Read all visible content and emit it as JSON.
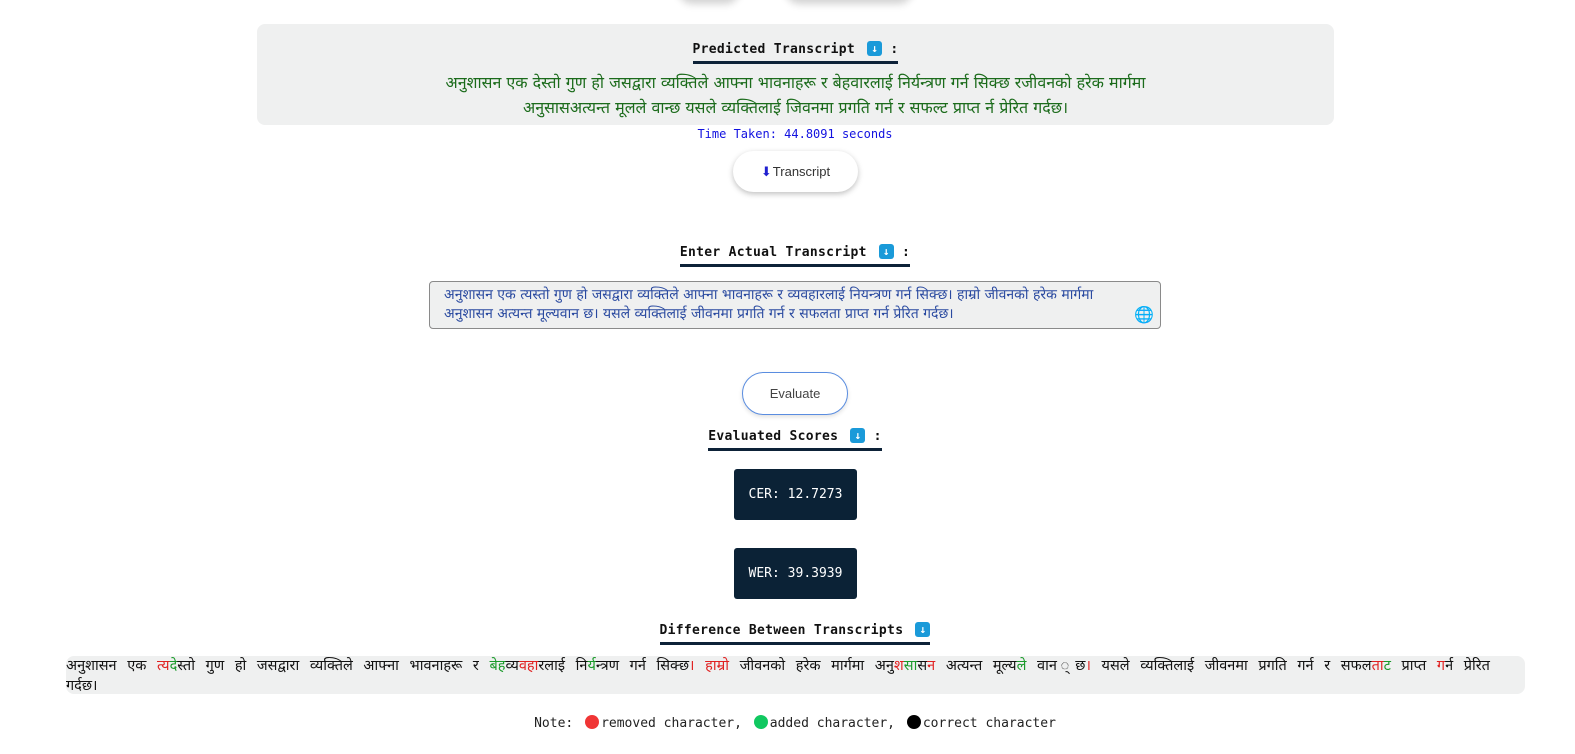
{
  "predicted": {
    "heading": "Predicted Transcript",
    "colon": ":",
    "download_icon": "download-arrow-icon",
    "text": "अनुशासन एक देस्तो गुण हो जसद्वारा व्यक्तिले आफ्ना भावनाहरू र बेहवारलाई निर्यन्त्रण गर्न सिक्छ रजीवनको हरेक मार्गमा अनुसासअत्यन्त मूलले वान्छ यसले व्यक्तिलाई जिवनमा प्रगति गर्न र सफल्ट प्राप्त र्न प्रेरित गर्दछ।",
    "text_color": "#1b6b1b"
  },
  "time_taken": "Time Taken: 44.8091 seconds",
  "transcript_button": {
    "label": "Transcript",
    "icon": "download-icon"
  },
  "actual": {
    "heading": "Enter Actual Transcript",
    "colon": ":",
    "value": "अनुशासन एक त्यस्तो गुण हो जसद्वारा व्यक्तिले आफ्ना भावनाहरू र व्यवहारलाई नियन्त्रण गर्न सिक्छ। हाम्रो जीवनको हरेक मार्गमा अनुशासन अत्यन्त मूल्यवान छ। यसले व्यक्तिलाई जीवनमा प्रगति गर्न र सफलता प्राप्त गर्न प्रेरित गर्दछ।",
    "clear_icon": "globe-clear-icon"
  },
  "evaluate_button": {
    "label": "Evaluate"
  },
  "scores": {
    "heading": "Evaluated Scores",
    "colon": ":",
    "cer": "CER: 12.7273",
    "wer": "WER: 39.3939"
  },
  "difference": {
    "heading": "Difference Between Transcripts",
    "segments": [
      {
        "t": "अनुशासन एक ",
        "c": "n"
      },
      {
        "t": "त्य",
        "c": "r"
      },
      {
        "t": "दे",
        "c": "g"
      },
      {
        "t": "स्तो गुण हो जसद्वारा व्यक्तिले आफ्ना भावनाहरू र ",
        "c": "n"
      },
      {
        "t": "बेह",
        "c": "g"
      },
      {
        "t": "व्य",
        "c": "n"
      },
      {
        "t": "वहा",
        "c": "r"
      },
      {
        "t": "रलाई नि",
        "c": "n"
      },
      {
        "t": "र्य",
        "c": "g"
      },
      {
        "t": "न्त्रण गर्न सिक्छ",
        "c": "n"
      },
      {
        "t": "। ",
        "c": "r"
      },
      {
        "t": "हाम्रो",
        "c": "r"
      },
      {
        "t": " जीवनको हरेक मार्गमा अनु",
        "c": "n"
      },
      {
        "t": "श",
        "c": "r"
      },
      {
        "t": "सा",
        "c": "g"
      },
      {
        "t": "स",
        "c": "n"
      },
      {
        "t": "न",
        "c": "r"
      },
      {
        "t": " अत्यन्त मूल्य",
        "c": "n"
      },
      {
        "t": "ले",
        "c": "g"
      },
      {
        "t": " वान ",
        "c": "n"
      },
      {
        "t": "्",
        "c": "r"
      },
      {
        "t": "छ",
        "c": "n"
      },
      {
        "t": "।",
        "c": "r"
      },
      {
        "t": " यसले व्यक्तिलाई जीवनमा प्रगति गर्न र सफल",
        "c": "n"
      },
      {
        "t": "ता",
        "c": "r"
      },
      {
        "t": "ट",
        "c": "g"
      },
      {
        "t": " प्राप्त ",
        "c": "n"
      },
      {
        "t": "ग",
        "c": "r"
      },
      {
        "t": "र्न प्रेरित गर्दछ।",
        "c": "n"
      }
    ]
  },
  "legend": {
    "prefix": "Note:",
    "items": [
      {
        "label": "removed character,",
        "color": "#f03535"
      },
      {
        "label": "added character,",
        "color": "#10c860"
      },
      {
        "label": "correct character",
        "color": "#000000"
      }
    ]
  }
}
